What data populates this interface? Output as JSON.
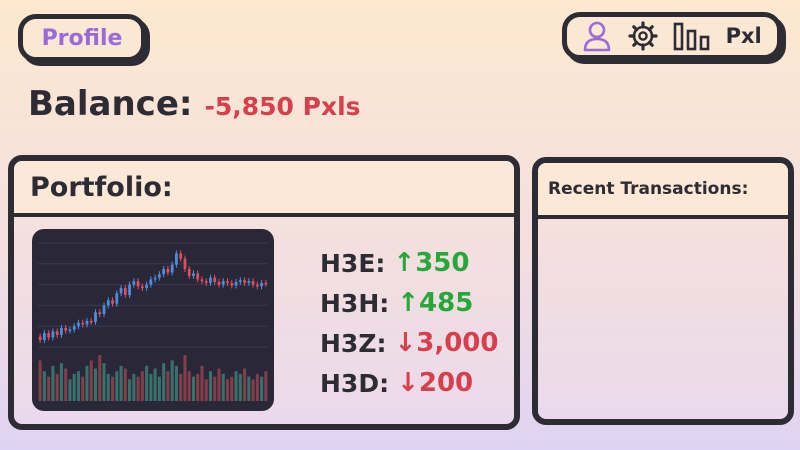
{
  "header": {
    "profile_label": "Profile",
    "brand_label": "Pxl",
    "icons": [
      "user-icon",
      "gear-icon",
      "bar-chart-icon"
    ]
  },
  "balance": {
    "label": "Balance:",
    "value": "-5,850 Pxls"
  },
  "portfolio": {
    "title": "Portfolio:",
    "holdings": [
      {
        "symbol": "H3E:",
        "direction": "up",
        "change": "↑350"
      },
      {
        "symbol": "H3H:",
        "direction": "up",
        "change": "↑485"
      },
      {
        "symbol": "H3Z:",
        "direction": "down",
        "change": "↓3,000"
      },
      {
        "symbol": "H3D:",
        "direction": "down",
        "change": "↓200"
      }
    ]
  },
  "recent": {
    "title": "Recent Transactions:",
    "items": []
  },
  "colors": {
    "accent_purple": "#9a6ad6",
    "up_green": "#27a63a",
    "down_red": "#d6404c",
    "outline": "#2d2b33"
  },
  "chart_data": {
    "type": "candlestick",
    "title": "",
    "xlabel": "",
    "ylabel": "",
    "ylim": [
      50,
      170
    ],
    "candles": [
      [
        62,
        58
      ],
      [
        58,
        66
      ],
      [
        66,
        61
      ],
      [
        61,
        68
      ],
      [
        68,
        64
      ],
      [
        64,
        72
      ],
      [
        72,
        69
      ],
      [
        69,
        70
      ],
      [
        70,
        74
      ],
      [
        74,
        78
      ],
      [
        78,
        76
      ],
      [
        76,
        80
      ],
      [
        80,
        79
      ],
      [
        79,
        90
      ],
      [
        90,
        88
      ],
      [
        88,
        98
      ],
      [
        98,
        104
      ],
      [
        104,
        100
      ],
      [
        100,
        112
      ],
      [
        112,
        118
      ],
      [
        118,
        110
      ],
      [
        110,
        122
      ],
      [
        122,
        126
      ],
      [
        126,
        120
      ],
      [
        120,
        118
      ],
      [
        118,
        122
      ],
      [
        122,
        128
      ],
      [
        128,
        130
      ],
      [
        130,
        134
      ],
      [
        134,
        140
      ],
      [
        140,
        136
      ],
      [
        136,
        145
      ],
      [
        145,
        158
      ],
      [
        158,
        152
      ],
      [
        152,
        140
      ],
      [
        140,
        132
      ],
      [
        132,
        135
      ],
      [
        135,
        128
      ],
      [
        128,
        126
      ],
      [
        126,
        124
      ],
      [
        124,
        130
      ],
      [
        130,
        125
      ],
      [
        125,
        122
      ],
      [
        122,
        126
      ],
      [
        126,
        124
      ],
      [
        124,
        121
      ],
      [
        121,
        125
      ],
      [
        125,
        127
      ],
      [
        127,
        124
      ],
      [
        124,
        126
      ],
      [
        126,
        122
      ],
      [
        122,
        120
      ],
      [
        120,
        124
      ],
      [
        124,
        123
      ]
    ],
    "volume": [
      30,
      22,
      18,
      26,
      20,
      28,
      24,
      16,
      20,
      22,
      18,
      26,
      30,
      24,
      34,
      28,
      20,
      18,
      22,
      26,
      24,
      16,
      20,
      18,
      22,
      26,
      20,
      24,
      18,
      28,
      22,
      30,
      26,
      20,
      34,
      22,
      18,
      20,
      26,
      16,
      22,
      18,
      24,
      20,
      16,
      18,
      22,
      20,
      24,
      18,
      16,
      20,
      18,
      22
    ]
  }
}
